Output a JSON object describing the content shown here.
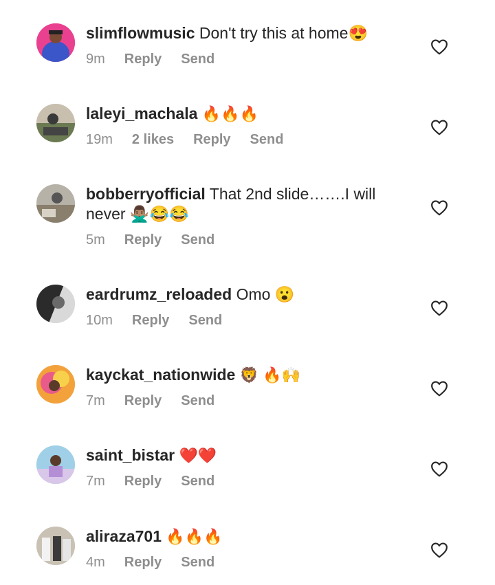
{
  "comments": [
    {
      "username": "slimflowmusic",
      "text": "Don't try this at home😍",
      "time": "9m",
      "likes": "",
      "reply": "Reply",
      "send": "Send"
    },
    {
      "username": "laleyi_machala",
      "text": "🔥🔥🔥",
      "time": "19m",
      "likes": "2 likes",
      "reply": "Reply",
      "send": "Send"
    },
    {
      "username": "bobberryofficial",
      "text": "That 2nd slide…….I will never 🙅🏽‍♂️😂😂",
      "time": "5m",
      "likes": "",
      "reply": "Reply",
      "send": "Send"
    },
    {
      "username": "eardrumz_reloaded",
      "text": "Omo 😮",
      "time": "10m",
      "likes": "",
      "reply": "Reply",
      "send": "Send"
    },
    {
      "username": "kayckat_nationwide",
      "text": "🦁 🔥🙌",
      "time": "7m",
      "likes": "",
      "reply": "Reply",
      "send": "Send"
    },
    {
      "username": "saint_bistar",
      "text": "❤️❤️",
      "time": "7m",
      "likes": "",
      "reply": "Reply",
      "send": "Send"
    },
    {
      "username": "aliraza701",
      "text": "🔥🔥🔥",
      "time": "4m",
      "likes": "",
      "reply": "Reply",
      "send": "Send"
    }
  ],
  "colors": {
    "text": "#262626",
    "secondary": "#8e8e8e",
    "background": "#ffffff"
  },
  "icons": {
    "like": "heart-outline-icon"
  }
}
